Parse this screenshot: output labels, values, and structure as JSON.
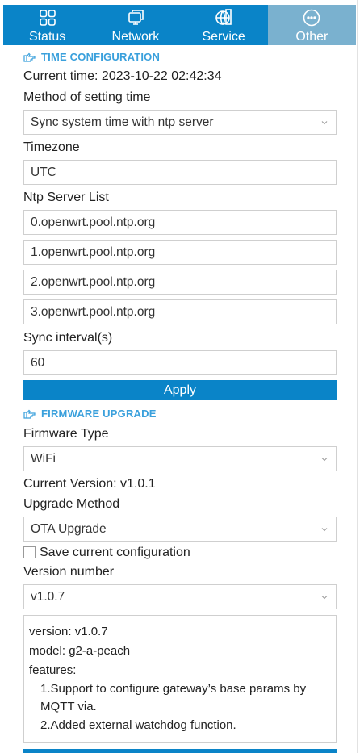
{
  "nav": {
    "items": [
      {
        "label": "Status",
        "icon": "grid-icon"
      },
      {
        "label": "Network",
        "icon": "monitor-icon"
      },
      {
        "label": "Service",
        "icon": "globe-icon"
      },
      {
        "label": "Other",
        "icon": "more-icon"
      }
    ],
    "active": "Other"
  },
  "time_config": {
    "title": "TIME CONFIGURATION",
    "current_time": "Current time: 2023-10-22 02:42:34",
    "method_label": "Method of setting time",
    "method_value": "Sync system time with ntp server",
    "timezone_label": "Timezone",
    "timezone_value": "UTC",
    "ntp_label": "Ntp Server List",
    "ntp_servers": [
      "0.openwrt.pool.ntp.org",
      "1.openwrt.pool.ntp.org",
      "2.openwrt.pool.ntp.org",
      "3.openwrt.pool.ntp.org"
    ],
    "interval_label": "Sync interval(s)",
    "interval_value": "60",
    "apply_label": "Apply"
  },
  "firmware": {
    "title": "FIRMWARE UPGRADE",
    "type_label": "Firmware Type",
    "type_value": "WiFi",
    "current_version": "Current Version: v1.0.1",
    "method_label": "Upgrade Method",
    "method_value": "OTA Upgrade",
    "save_config_label": "Save current configuration",
    "save_config_checked": false,
    "version_label": "Version number",
    "version_value": "v1.0.7",
    "details": {
      "version": "version: v1.0.7",
      "model": "model: g2-a-peach",
      "features_label": "features:",
      "feature_1": "1.Support to configure gateway’s base params by MQTT via.",
      "feature_2": "2.Added external watchdog function."
    }
  },
  "colors": {
    "accent": "#0a84c8",
    "active_tab": "#7ab1cf",
    "section_title": "#3aa0dc"
  }
}
